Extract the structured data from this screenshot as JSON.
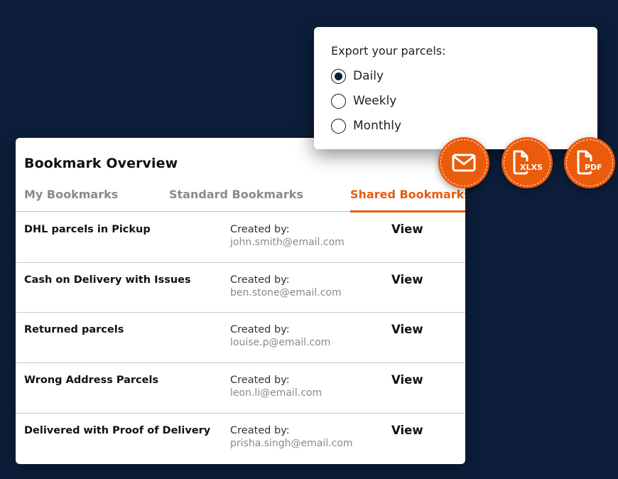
{
  "bookmarks": {
    "title": "Bookmark Overview",
    "tabs": [
      {
        "label": "My Bookmarks",
        "active": false
      },
      {
        "label": "Standard Bookmarks",
        "active": false
      },
      {
        "label": "Shared Bookmarks",
        "active": true
      }
    ],
    "rows": [
      {
        "name": "DHL parcels in Pickup",
        "created_label": "Created by:",
        "email": "john.smith@email.com",
        "action": "View"
      },
      {
        "name": "Cash on Delivery with Issues",
        "created_label": "Created by:",
        "email": "ben.stone@email.com",
        "action": "View"
      },
      {
        "name": "Returned parcels",
        "created_label": "Created by:",
        "email": "louise.p@email.com",
        "action": "View"
      },
      {
        "name": "Wrong Address Parcels",
        "created_label": "Created by:",
        "email": "leon.li@email.com",
        "action": "View"
      },
      {
        "name": "Delivered with Proof of Delivery",
        "created_label": "Created by:",
        "email": "prisha.singh@email.com",
        "action": "View"
      }
    ]
  },
  "export": {
    "title": "Export your parcels:",
    "options": [
      {
        "label": "Daily",
        "selected": true
      },
      {
        "label": "Weekly",
        "selected": false
      },
      {
        "label": "Monthly",
        "selected": false
      }
    ]
  },
  "actions": {
    "email": {
      "icon": "mail-icon"
    },
    "xlsx": {
      "icon": "xlsx-file-icon",
      "label": "XLXS"
    },
    "pdf": {
      "icon": "pdf-file-icon",
      "label": "PDF"
    }
  },
  "colors": {
    "background": "#0c1e3a",
    "accent": "#ea5b0c",
    "card": "#ffffff"
  }
}
